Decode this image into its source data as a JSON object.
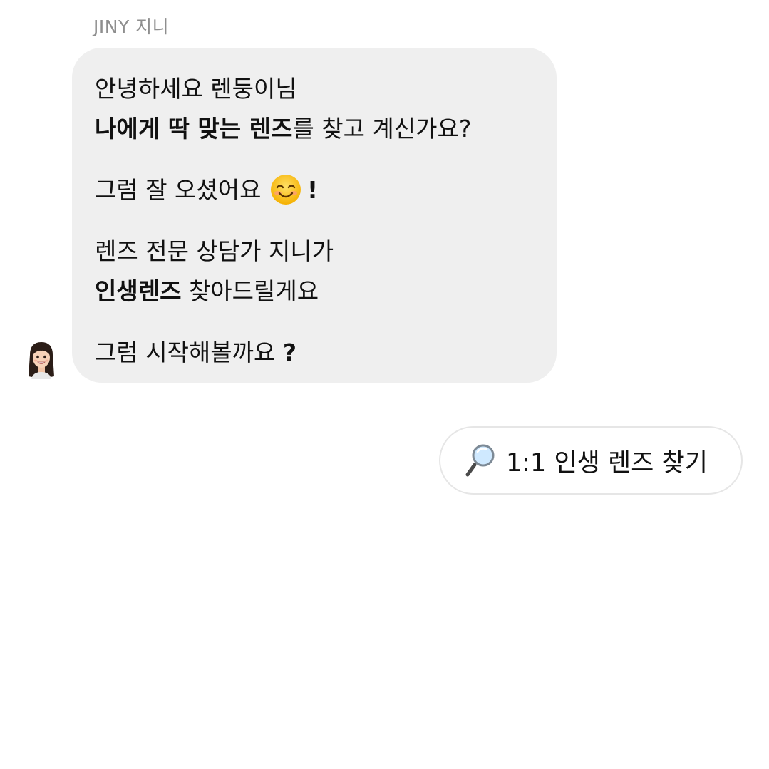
{
  "sender": {
    "name": "JINY 지니"
  },
  "message": {
    "lines": [
      {
        "parts": [
          {
            "text": "안녕하세요 렌둥이님",
            "bold": false
          }
        ]
      },
      {
        "parts": [
          {
            "text": "나에게 딱 맞는 렌즈",
            "bold": true
          },
          {
            "text": "를 찾고 계신가요?",
            "bold": false
          }
        ]
      },
      {
        "parts": [
          {
            "text": "그럼 잘 오셨어요 ",
            "bold": false
          },
          {
            "emoji": "smiling-face-icon"
          },
          {
            "text": "!",
            "bold": true
          }
        ]
      },
      {
        "parts": [
          {
            "text": "렌즈 전문 상담가 지니가",
            "bold": false
          }
        ]
      },
      {
        "parts": [
          {
            "text": "인생렌즈",
            "bold": true
          },
          {
            "text": " 찾아드릴게요",
            "bold": false
          }
        ]
      },
      {
        "parts": [
          {
            "text": "그럼 시작해볼까요 ",
            "bold": false
          },
          {
            "text": "?",
            "bold": true
          }
        ]
      }
    ]
  },
  "quick_reply": {
    "icon": "magnifying-glass-icon",
    "label": "1:1 인생 렌즈 찾기"
  },
  "colors": {
    "bubble_bg": "#efefef",
    "sender_name": "#8e8e8e",
    "reply_border": "#e6e6e6"
  }
}
